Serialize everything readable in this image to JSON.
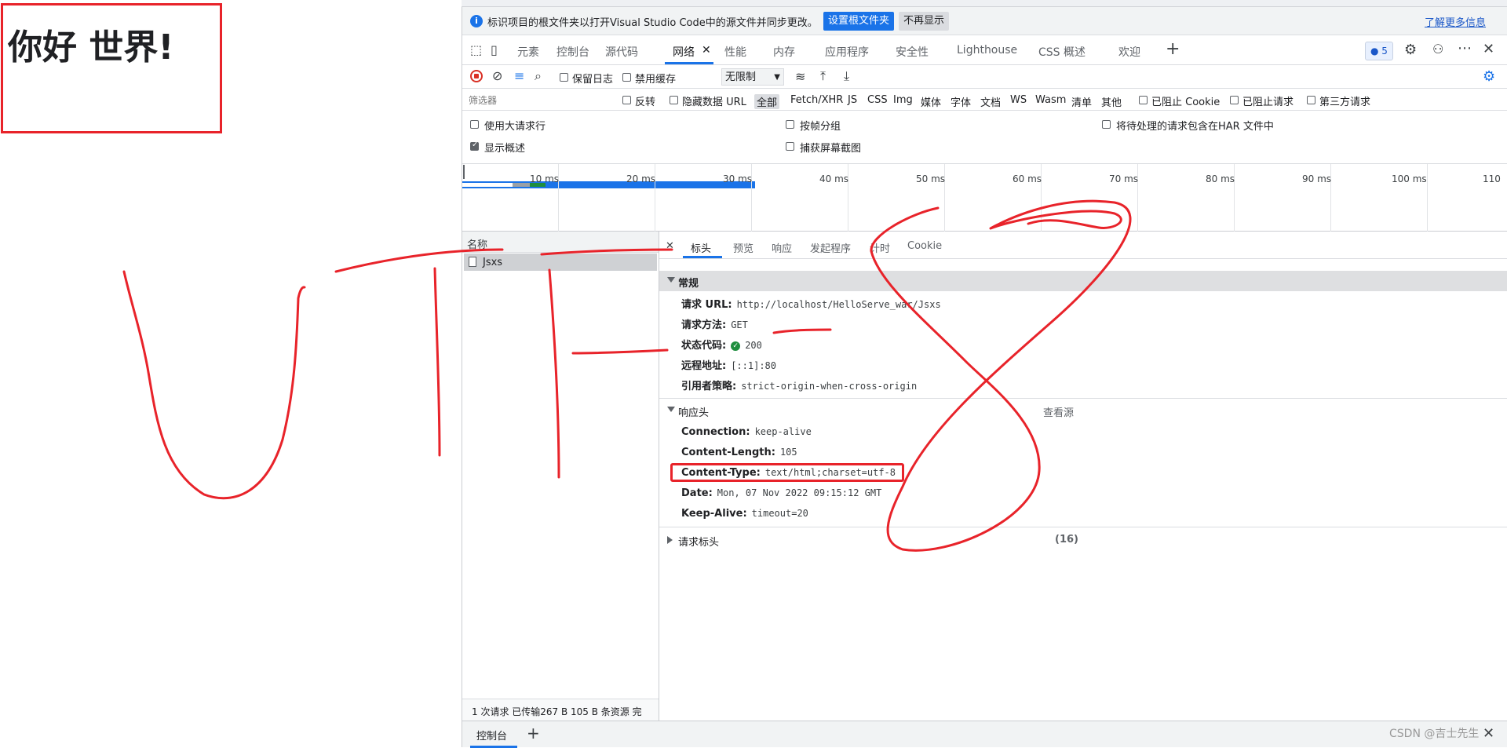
{
  "page": {
    "heading": "你好 世界!"
  },
  "infobar": {
    "text": "标识项目的根文件夹以打开Visual Studio Code中的源文件并同步更改。",
    "open_button": "设置根文件夹",
    "dismiss_button": "不再显示",
    "learn_more": "了解更多信息"
  },
  "tabs": [
    {
      "label": "元素"
    },
    {
      "label": "控制台"
    },
    {
      "label": "源代码"
    },
    {
      "label": "网络"
    },
    {
      "label": "性能"
    },
    {
      "label": "内存"
    },
    {
      "label": "应用程序"
    },
    {
      "label": "安全性"
    },
    {
      "label": "Lighthouse"
    },
    {
      "label": "CSS 概述"
    },
    {
      "label": "欢迎"
    }
  ],
  "issues_count": "5",
  "toolbar": {
    "preserve_log": "保留日志",
    "disable_cache": "禁用缓存",
    "throttle": "无限制"
  },
  "filter": {
    "placeholder": "筛选器",
    "invert": "反转",
    "hide_data_urls": "隐藏数据 URL",
    "types": [
      "全部",
      "Fetch/XHR",
      "JS",
      "CSS",
      "Img",
      "媒体",
      "字体",
      "文档",
      "WS",
      "Wasm",
      "清单",
      "其他"
    ],
    "blocked_cookies": "已阻止 Cookie",
    "blocked_requests": "已阻止请求",
    "third_party": "第三方请求"
  },
  "options": {
    "large_rows": "使用大请求行",
    "group_by_frame": "按帧分组",
    "har_pending": "将待处理的请求包含在HAR 文件中",
    "show_overview": "显示概述",
    "capture_screenshots": "捕获屏幕截图"
  },
  "overview": {
    "ticks": [
      "10 ms",
      "20 ms",
      "30 ms",
      "40 ms",
      "50 ms",
      "60 ms",
      "70 ms",
      "80 ms",
      "90 ms",
      "100 ms",
      "110"
    ]
  },
  "requests": {
    "header": "名称",
    "rows": [
      {
        "name": "Jsxs"
      }
    ],
    "summary": "1 次请求  已传输267 B  105 B 条资源  完"
  },
  "details": {
    "tabs": [
      "标头",
      "预览",
      "响应",
      "发起程序",
      "计时",
      "Cookie"
    ],
    "general": {
      "title": "常规",
      "request_url_k": "请求 URL:",
      "request_url_v": "http://localhost/HelloServe_war/Jsxs",
      "method_k": "请求方法:",
      "method_v": "GET",
      "status_k": "状态代码:",
      "status_v": "200",
      "remote_k": "远程地址:",
      "remote_v": "[::1]:80",
      "referrer_k": "引用者策略:",
      "referrer_v": "strict-origin-when-cross-origin"
    },
    "response": {
      "title": "响应头",
      "view_source": "查看源",
      "connection_k": "Connection:",
      "connection_v": "keep-alive",
      "length_k": "Content-Length:",
      "length_v": "105",
      "type_k": "Content-Type:",
      "type_v": "text/html;charset=utf-8",
      "date_k": "Date:",
      "date_v": "Mon, 07 Nov 2022 09:15:12 GMT",
      "keepalive_k": "Keep-Alive:",
      "keepalive_v": "timeout=20"
    },
    "request_headers": {
      "title": "请求标头",
      "count": "(16)"
    }
  },
  "drawer": {
    "tab": "控制台"
  },
  "watermark": "CSDN @吉士先生",
  "colors": {
    "accent": "#1a73e8",
    "annotation": "#e8232a",
    "success": "#1e8e3e"
  }
}
